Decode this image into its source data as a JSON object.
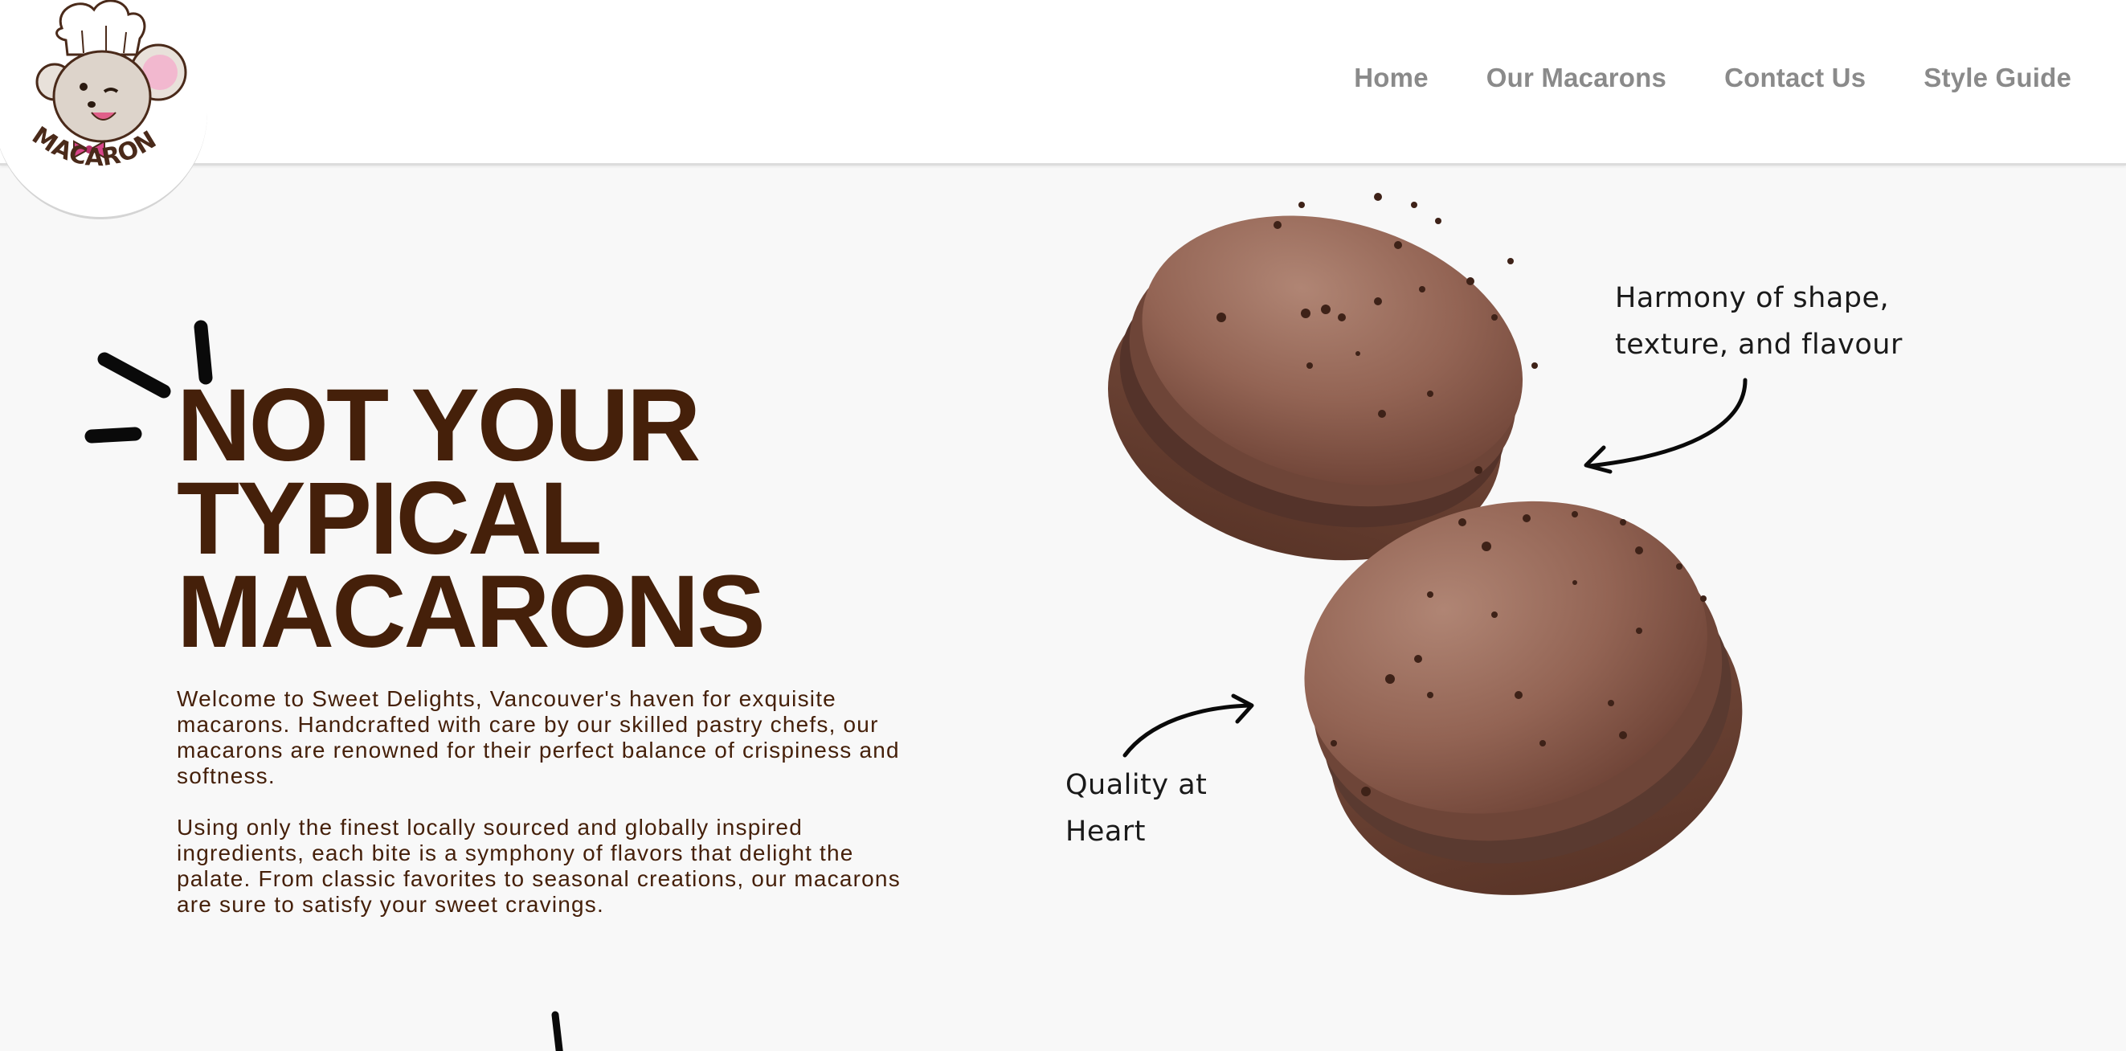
{
  "brand": {
    "logo_text": "MACARON",
    "logo_icon": "chef-mouse-logo"
  },
  "nav": {
    "items": [
      {
        "label": "Home"
      },
      {
        "label": "Our Macarons"
      },
      {
        "label": "Contact Us"
      },
      {
        "label": "Style Guide"
      }
    ]
  },
  "hero": {
    "title_lines": [
      "NOT YOUR",
      "TYPICAL",
      "MACARONS"
    ],
    "paragraphs": [
      "Welcome to Sweet Delights, Vancouver's haven for exquisite macarons. Handcrafted with care by our skilled pastry chefs, our macarons are renowned for their perfect balance of crispiness and softness.",
      "Using only the finest locally sourced and globally inspired ingredients, each bite is a symphony of flavors that delight the palate. From classic favorites to seasonal creations, our macarons are sure to satisfy your sweet cravings."
    ]
  },
  "annotations": {
    "top_right": [
      "Harmony of shape,",
      "texture, and flavour"
    ],
    "bottom_left": [
      "Quality at",
      "Heart"
    ]
  },
  "colors": {
    "accent_brown": "#45200a",
    "nav_gray": "#8a8a8a",
    "background": "#f8f8f8",
    "macaron_shell": "#8a5a4a",
    "macaron_filling": "#5e3a2e"
  }
}
